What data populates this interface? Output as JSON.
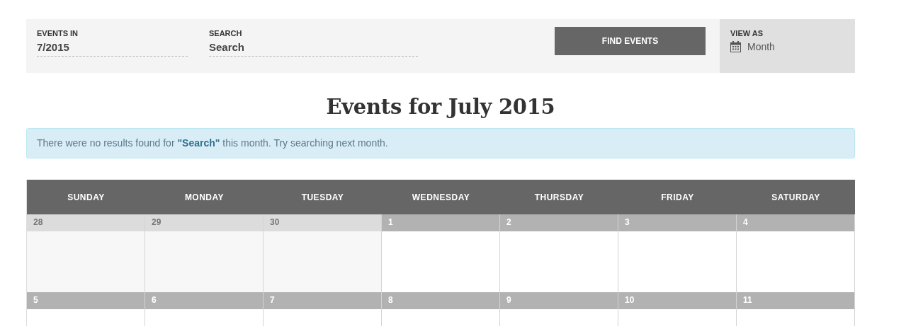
{
  "filter_bar": {
    "fields": [
      {
        "label": "EVENTS IN",
        "value": "7/2015"
      },
      {
        "label": "SEARCH",
        "value": "Search"
      }
    ],
    "submit_button": "FIND EVENTS",
    "view_as": {
      "label": "VIEW AS",
      "value": "Month"
    }
  },
  "title": "Events for July 2015",
  "notice": "There were no results found for **\"Search\"** this month. Try searching next month.",
  "calendar": {
    "weekdays": [
      "SUNDAY",
      "MONDAY",
      "TUESDAY",
      "WEDNESDAY",
      "THURSDAY",
      "FRIDAY",
      "SATURDAY"
    ],
    "weeks": [
      [
        {
          "day": "28",
          "other_month": true
        },
        {
          "day": "29",
          "other_month": true
        },
        {
          "day": "30",
          "other_month": true
        },
        {
          "day": "1",
          "other_month": false
        },
        {
          "day": "2",
          "other_month": false
        },
        {
          "day": "3",
          "other_month": false
        },
        {
          "day": "4",
          "other_month": false
        }
      ],
      [
        {
          "day": "5",
          "other_month": false
        },
        {
          "day": "6",
          "other_month": false
        },
        {
          "day": "7",
          "other_month": false
        },
        {
          "day": "8",
          "other_month": false
        },
        {
          "day": "9",
          "other_month": false
        },
        {
          "day": "10",
          "other_month": false
        },
        {
          "day": "11",
          "other_month": false
        }
      ]
    ]
  }
}
